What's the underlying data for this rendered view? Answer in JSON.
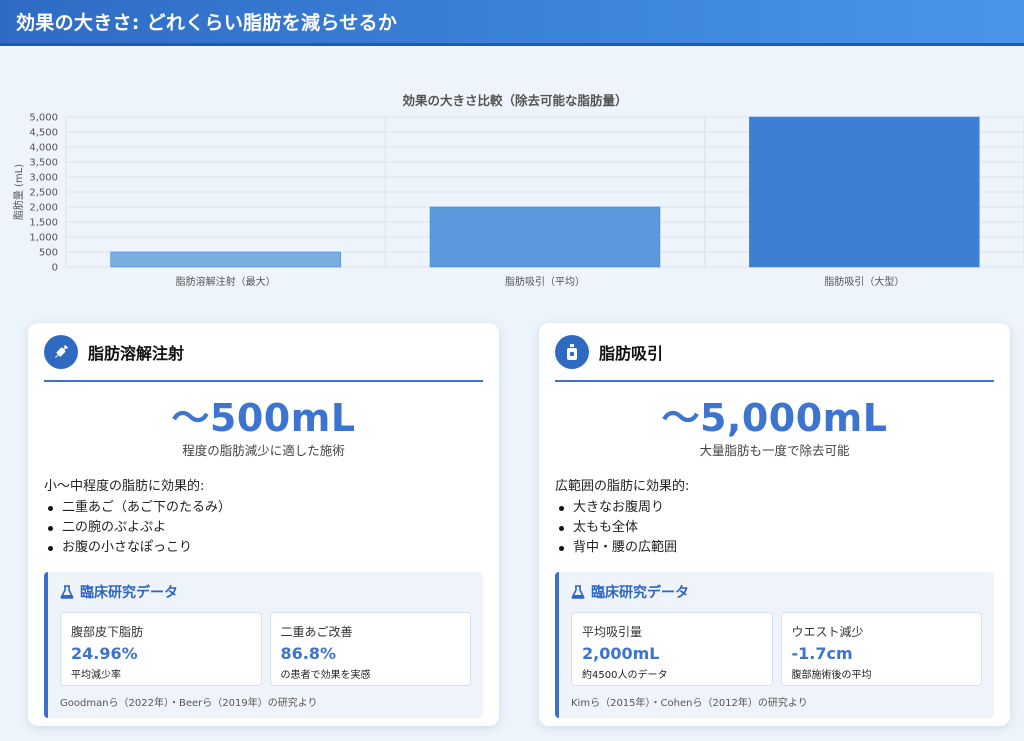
{
  "header": {
    "title": "効果の大きさ: どれくらい脂肪を減らせるか"
  },
  "chart_data": {
    "type": "bar",
    "title": "効果の大きさ比較（除去可能な脂肪量）",
    "ylabel": "脂肪量 (mL)",
    "xlabel": "",
    "categories": [
      "脂肪溶解注射（最大）",
      "脂肪吸引（平均）",
      "脂肪吸引（大型）"
    ],
    "values": [
      500,
      2000,
      5000
    ],
    "ylim": [
      0,
      5000
    ],
    "yticks": [
      "0",
      "500",
      "1,000",
      "1,500",
      "2,000",
      "2,500",
      "3,000",
      "3,500",
      "4,000",
      "4,500",
      "5,000"
    ],
    "bar_colors": [
      "#7aaee3",
      "#5a99dc",
      "#3c7fd4"
    ],
    "grid": true
  },
  "cards": [
    {
      "icon": "syringe-icon",
      "title": "脂肪溶解注射",
      "big_value": "〜500mL",
      "sub_value": "程度の脂肪減少に適した施術",
      "desc_head": "小〜中程度の脂肪に効果的:",
      "points": [
        "二重あご（あご下のたるみ）",
        "二の腕のぷよぷよ",
        "お腹の小さなぽっこり"
      ],
      "research_title": "臨床研究データ",
      "stats": [
        {
          "label": "腹部皮下脂肪",
          "value": "24.96%",
          "note": "平均減少率"
        },
        {
          "label": "二重あご改善",
          "value": "86.8%",
          "note": "の患者で効果を実感"
        }
      ],
      "source": "Goodmanら（2022年）・Beerら（2019年）の研究より"
    },
    {
      "icon": "suction-bottle-icon",
      "title": "脂肪吸引",
      "big_value": "〜5,000mL",
      "sub_value": "大量脂肪も一度で除去可能",
      "desc_head": "広範囲の脂肪に効果的:",
      "points": [
        "大きなお腹周り",
        "太もも全体",
        "背中・腰の広範囲"
      ],
      "research_title": "臨床研究データ",
      "stats": [
        {
          "label": "平均吸引量",
          "value": "2,000mL",
          "note": "約4500人のデータ"
        },
        {
          "label": "ウエスト減少",
          "value": "-1.7cm",
          "note": "腹部施術後の平均"
        }
      ],
      "source": "Kimら（2015年）・Cohenら（2012年）の研究より"
    }
  ],
  "colors": {
    "accent": "#3c74d0",
    "header": "#2f6bc4"
  }
}
